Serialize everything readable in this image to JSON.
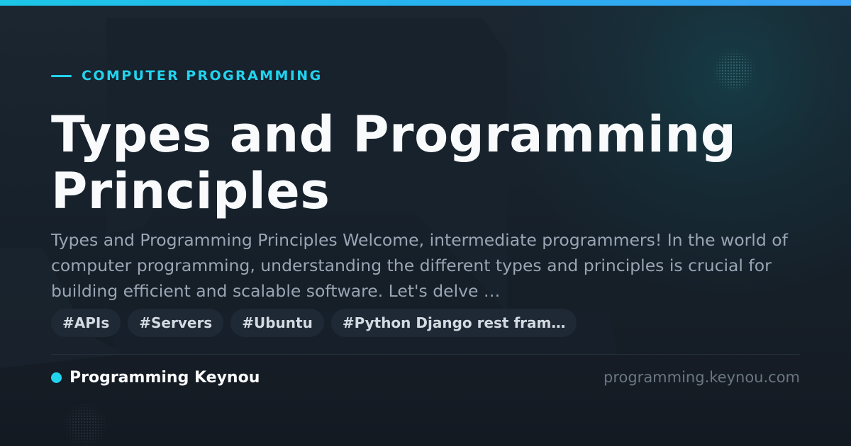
{
  "accent_color": "#22d3ee",
  "background_color": "#141a22",
  "category": "COMPUTER PROGRAMMING",
  "title": "Types and Programming Principles",
  "description": "Types and Programming Principles Welcome, intermediate programmers! In the world of computer programming, understanding the different types and principles is crucial for building efficient and scalable software. Let's delve …",
  "tags": [
    {
      "label": "#APIs"
    },
    {
      "label": "#Servers"
    },
    {
      "label": "#Ubuntu"
    },
    {
      "label": "#Python Django rest fram…"
    }
  ],
  "footer": {
    "brand_name": "Programming Keynou",
    "site_url": "programming.keynou.com"
  }
}
